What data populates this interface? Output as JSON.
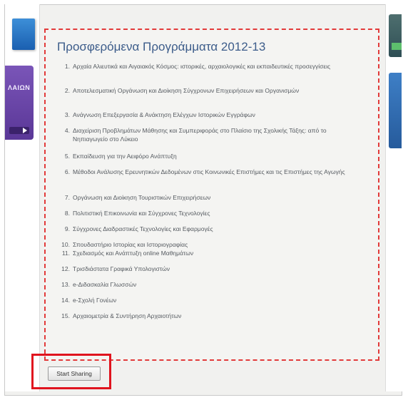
{
  "panel": {
    "title": "Προσφερόμενα Προγράμματα 2012-13",
    "courses": [
      {
        "num": "1.",
        "text": "Αρχαία Αλιευτικά και Αιγαιακός Κόσμος: ιστορικές, αρχαιολογικές και εκπαιδευτικές προσεγγίσεις"
      },
      {
        "num": "2.",
        "text": "Αποτελεσματική Οργάνωση και Διοίκηση Σύγχρονων Επιχειρήσεων και Οργανισμών"
      },
      {
        "num": "3.",
        "text": "Ανάγνωση Επεξεργασία & Ανάκτηση Ελέγχων Ιστορικών Εγγράφων"
      },
      {
        "num": "4.",
        "text": "Διαχείριση Προβλημάτων Μάθησης και Συμπεριφοράς στο Πλαίσιο της Σχολικής Τάξης: από το Νηπιαγωγείο στο Λύκειο"
      },
      {
        "num": "5.",
        "text": "Εκπαίδευση για την Αειφόρο Ανάπτυξη"
      },
      {
        "num": "6.",
        "text": "Μέθοδοι Ανάλυσης Ερευνητικών Δεδομένων στις Κοινωνικές Επιστήμες και τις Επιστήμες της Αγωγής"
      },
      {
        "num": "7.",
        "text": "Οργάνωση και Διοίκηση Τουριστικών Επιχειρήσεων"
      },
      {
        "num": "8.",
        "text": "Πολιτιστική Επικοινωνία και Σύγχρονες Τεχνολογίες"
      },
      {
        "num": "9.",
        "text": "Σύγχρονες Διαδραστικές Τεχνολογίες και Εφαρμογές"
      },
      {
        "num": "10.",
        "text": "Σπουδαστήριο Ιστορίας και Ιστοριογραφίας"
      },
      {
        "num": "11.",
        "text": "Σχεδιασμός και Ανάπτυξη online Μαθημάτων"
      },
      {
        "num": "12.",
        "text": "Τρισδιάστατα Γραφικά Υπολογιστών"
      },
      {
        "num": "13.",
        "text": "e-Διδασκαλία Γλωσσών"
      },
      {
        "num": "14.",
        "text": "e-Σχολή Γονέων"
      },
      {
        "num": "15.",
        "text": "Αρχαιομετρία & Συντήρηση Αρχαιοτήτων"
      }
    ]
  },
  "left_banner": {
    "text": "ΛΑΙΩΝ"
  },
  "start_button": {
    "label": "Start Sharing"
  },
  "colors": {
    "title": "#3c5c8a",
    "dashed_border": "#e23a3a",
    "highlight": "#e0141e"
  }
}
